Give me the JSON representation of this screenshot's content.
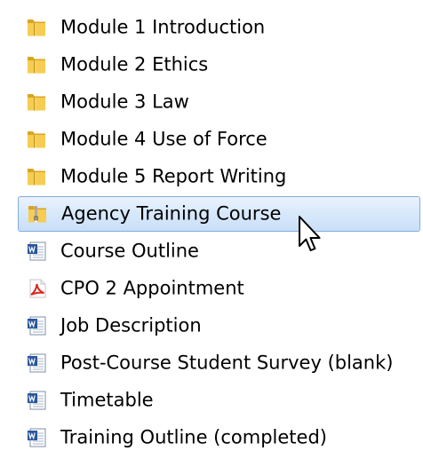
{
  "explorer": {
    "items": [
      {
        "label": "Module 1 Introduction",
        "icon": "folder-icon"
      },
      {
        "label": "Module 2 Ethics",
        "icon": "folder-icon"
      },
      {
        "label": "Module 3 Law",
        "icon": "folder-icon"
      },
      {
        "label": "Module 4 Use of Force",
        "icon": "folder-icon"
      },
      {
        "label": "Module 5 Report Writing",
        "icon": "folder-icon"
      },
      {
        "label": "Agency Training Course",
        "icon": "zip-folder-icon",
        "selected": true
      },
      {
        "label": "Course Outline",
        "icon": "word-document-icon"
      },
      {
        "label": "CPO 2 Appointment",
        "icon": "pdf-document-icon"
      },
      {
        "label": "Job Description",
        "icon": "word-document-icon"
      },
      {
        "label": "Post-Course Student Survey (blank)",
        "icon": "word-document-icon"
      },
      {
        "label": "Timetable",
        "icon": "word-document-icon"
      },
      {
        "label": "Training Outline (completed)",
        "icon": "word-document-icon"
      }
    ],
    "colors": {
      "selection_fill": "#d9e9fb",
      "selection_border": "#84acdd",
      "folder_yellow": "#f3c64a",
      "word_blue": "#2a5699",
      "pdf_red": "#d9251d"
    }
  }
}
